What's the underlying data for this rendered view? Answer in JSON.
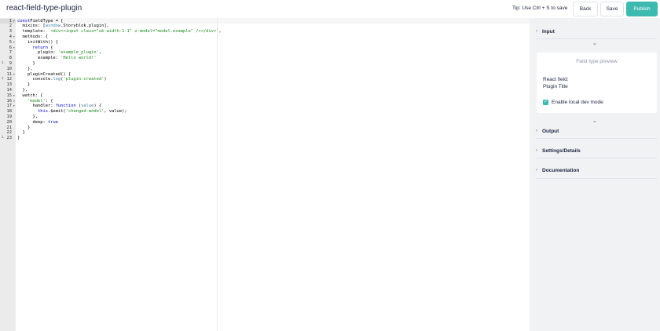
{
  "header": {
    "title": "react-field-type-plugin",
    "tip": "Tip: Use Ctrl + S to save",
    "back_label": "Back",
    "save_label": "Save",
    "publish_label": "Publish"
  },
  "editor": {
    "lines": [
      {
        "n": "1",
        "fold": true,
        "warn": false,
        "parts": [
          [
            "kw",
            "const"
          ],
          [
            "",
            "FieldType = {"
          ]
        ]
      },
      {
        "n": "2",
        "fold": false,
        "warn": false,
        "parts": [
          [
            "",
            "  mixins: ["
          ],
          [
            "fn",
            "window"
          ],
          [
            "",
            ".Storyblok.plugin],"
          ]
        ]
      },
      {
        "n": "3",
        "fold": false,
        "warn": false,
        "parts": [
          [
            "",
            "  template: "
          ],
          [
            "str",
            "`<div><input class=\"uk-width-1-1\" v-model=\"model.example\" /></div>`"
          ],
          [
            "",
            ","
          ]
        ]
      },
      {
        "n": "4",
        "fold": true,
        "warn": false,
        "parts": [
          [
            "",
            "  methods: {"
          ]
        ]
      },
      {
        "n": "5",
        "fold": true,
        "warn": false,
        "parts": [
          [
            "",
            "    initWith() {"
          ]
        ]
      },
      {
        "n": "6",
        "fold": true,
        "warn": false,
        "parts": [
          [
            "",
            "      "
          ],
          [
            "kw",
            "return"
          ],
          [
            "",
            " {"
          ]
        ]
      },
      {
        "n": "7",
        "fold": false,
        "warn": false,
        "parts": [
          [
            "",
            "        plugin: "
          ],
          [
            "str",
            "'example_plugin'"
          ],
          [
            "",
            ","
          ]
        ]
      },
      {
        "n": "8",
        "fold": false,
        "warn": false,
        "parts": [
          [
            "",
            "        example: "
          ],
          [
            "str",
            "'Hello world!'"
          ]
        ]
      },
      {
        "n": "9",
        "fold": false,
        "warn": true,
        "parts": [
          [
            "",
            "      }"
          ]
        ]
      },
      {
        "n": "10",
        "fold": false,
        "warn": false,
        "parts": [
          [
            "",
            "    },"
          ]
        ]
      },
      {
        "n": "11",
        "fold": true,
        "warn": false,
        "parts": [
          [
            "",
            "    pluginCreated() {"
          ]
        ]
      },
      {
        "n": "12",
        "fold": false,
        "warn": true,
        "parts": [
          [
            "",
            "      console."
          ],
          [
            "fn",
            "log"
          ],
          [
            "",
            "("
          ],
          [
            "str",
            "'plugin:created'"
          ],
          [
            "",
            ")"
          ]
        ]
      },
      {
        "n": "13",
        "fold": false,
        "warn": false,
        "parts": [
          [
            "",
            "    }"
          ]
        ]
      },
      {
        "n": "14",
        "fold": false,
        "warn": false,
        "parts": [
          [
            "",
            "  },"
          ]
        ]
      },
      {
        "n": "15",
        "fold": true,
        "warn": false,
        "parts": [
          [
            "",
            "  watch: {"
          ]
        ]
      },
      {
        "n": "16",
        "fold": true,
        "warn": false,
        "parts": [
          [
            "",
            "    "
          ],
          [
            "str",
            "'model'"
          ],
          [
            "",
            ": {"
          ]
        ]
      },
      {
        "n": "17",
        "fold": true,
        "warn": false,
        "parts": [
          [
            "",
            "      handler: "
          ],
          [
            "kw",
            "function"
          ],
          [
            "",
            " ("
          ],
          [
            "fn",
            "value"
          ],
          [
            "",
            ") {"
          ]
        ]
      },
      {
        "n": "18",
        "fold": false,
        "warn": false,
        "parts": [
          [
            "",
            "        "
          ],
          [
            "kw",
            "this"
          ],
          [
            "",
            ".$emit("
          ],
          [
            "str",
            "'changed-model'"
          ],
          [
            "",
            ", value);"
          ]
        ]
      },
      {
        "n": "19",
        "fold": false,
        "warn": false,
        "parts": [
          [
            "",
            "      },"
          ]
        ]
      },
      {
        "n": "20",
        "fold": false,
        "warn": false,
        "parts": [
          [
            "",
            "      deep: "
          ],
          [
            "kw",
            "true"
          ]
        ]
      },
      {
        "n": "21",
        "fold": false,
        "warn": false,
        "parts": [
          [
            "",
            "    }"
          ]
        ]
      },
      {
        "n": "22",
        "fold": false,
        "warn": false,
        "parts": [
          [
            "",
            "  }"
          ]
        ]
      },
      {
        "n": "23",
        "fold": false,
        "warn": true,
        "parts": [
          [
            "",
            "}"
          ]
        ]
      }
    ]
  },
  "panel": {
    "sections": {
      "input": "Input",
      "output": "Output",
      "settings": "Settings/Details",
      "documentation": "Documentation"
    },
    "preview": {
      "title": "Field type preview",
      "field_label": "React field:",
      "field_value": "Plugin Title",
      "dev_mode_label": "Enable local dev mode",
      "dev_mode_checked": true
    },
    "icons": {
      "caret": "caret-right-icon",
      "chevron": "chevron-down-icon",
      "check": "check-icon"
    }
  },
  "colors": {
    "accent": "#3dbab0",
    "panel_bg": "#f1f2f4",
    "gutter_bg": "#ebebeb",
    "keyword": "#0000cc",
    "string": "#1a8a1a"
  }
}
